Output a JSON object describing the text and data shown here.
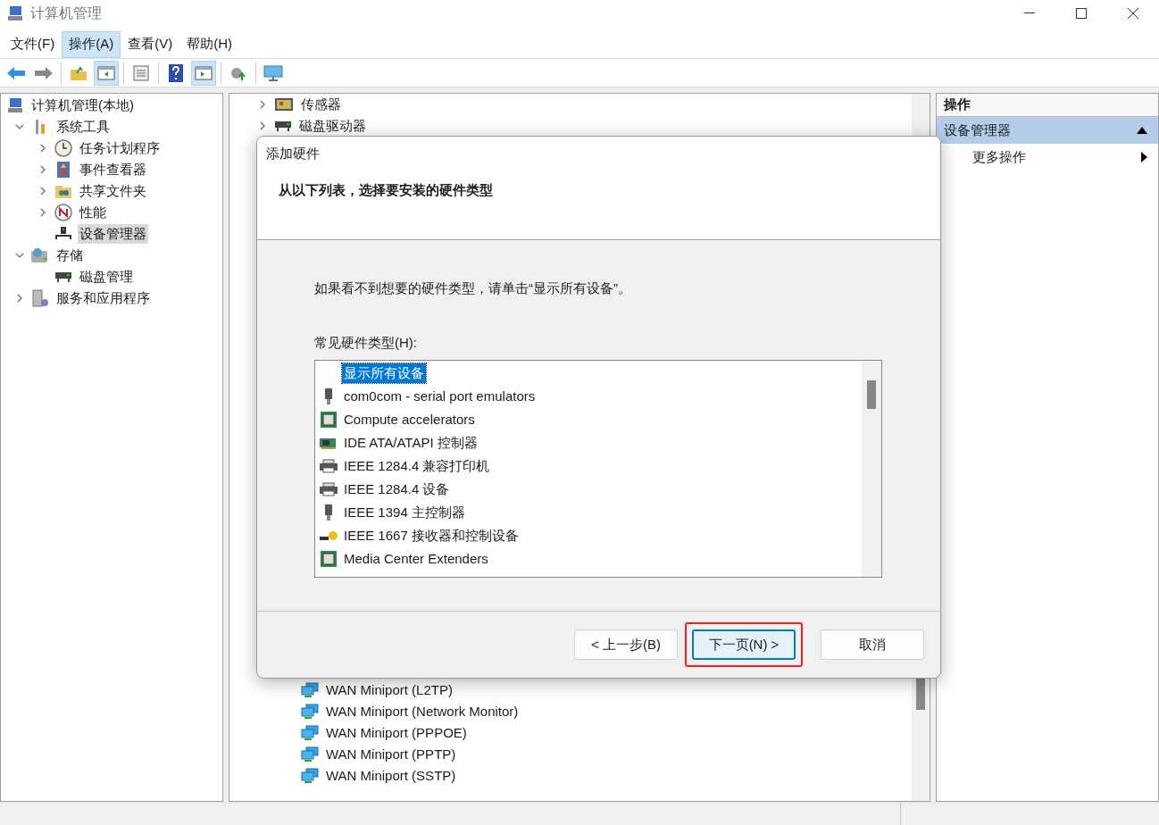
{
  "window": {
    "title": "计算机管理"
  },
  "menu": [
    {
      "label": "文件(F)",
      "selected": false
    },
    {
      "label": "操作(A)",
      "selected": true
    },
    {
      "label": "查看(V)",
      "selected": false
    },
    {
      "label": "帮助(H)",
      "selected": false
    }
  ],
  "toolbar": [
    {
      "kind": "back",
      "pressed": false
    },
    {
      "kind": "forward",
      "pressed": false
    },
    {
      "kind": "sep"
    },
    {
      "kind": "up",
      "pressed": false
    },
    {
      "kind": "tree",
      "pressed": true
    },
    {
      "kind": "sep"
    },
    {
      "kind": "props",
      "pressed": false
    },
    {
      "kind": "sep"
    },
    {
      "kind": "help",
      "pressed": false
    },
    {
      "kind": "pane",
      "pressed": true
    },
    {
      "kind": "sep"
    },
    {
      "kind": "export",
      "pressed": false
    },
    {
      "kind": "sep"
    },
    {
      "kind": "monitor",
      "pressed": false
    }
  ],
  "tree": [
    {
      "label": "计算机管理(本地)",
      "kind": "computer",
      "selected": false,
      "children": [
        {
          "label": "系统工具",
          "kind": "tools",
          "expanded": true,
          "selected": false,
          "children": [
            {
              "label": "任务计划程序",
              "kind": "clock",
              "expanded": false,
              "selected": false
            },
            {
              "label": "事件查看器",
              "kind": "log",
              "expanded": false,
              "selected": false
            },
            {
              "label": "共享文件夹",
              "kind": "share",
              "expanded": false,
              "selected": false
            },
            {
              "label": "性能",
              "kind": "perf",
              "expanded": false,
              "selected": false
            },
            {
              "label": "设备管理器",
              "kind": "device",
              "selected": true
            }
          ]
        },
        {
          "label": "存储",
          "kind": "storage",
          "expanded": true,
          "selected": false,
          "children": [
            {
              "label": "磁盘管理",
              "kind": "disk",
              "selected": false
            }
          ]
        },
        {
          "label": "服务和应用程序",
          "kind": "services",
          "expanded": false,
          "selected": false
        }
      ]
    }
  ],
  "device_list_top": [
    {
      "label": "传感器",
      "kind": "sensor"
    },
    {
      "label": "磁盘驱动器",
      "kind": "disk"
    }
  ],
  "device_list_bottom": [
    {
      "label": "WAN Miniport (L2TP)"
    },
    {
      "label": "WAN Miniport (Network Monitor)"
    },
    {
      "label": "WAN Miniport (PPPOE)"
    },
    {
      "label": "WAN Miniport (PPTP)"
    },
    {
      "label": "WAN Miniport (SSTP)"
    }
  ],
  "actions": {
    "header": "操作",
    "section": {
      "label": "设备管理器",
      "expanded": true
    },
    "items": [
      {
        "label": "更多操作"
      }
    ]
  },
  "dialog": {
    "title": "添加硬件",
    "heading": "从以下列表，选择要安装的硬件类型",
    "hint": "如果看不到想要的硬件类型，请单击“显示所有设备”。",
    "list_label": "常见硬件类型(H):",
    "items": [
      {
        "label": "显示所有设备",
        "kind": "none",
        "selected": true
      },
      {
        "label": "com0com - serial port emulators",
        "kind": "port",
        "selected": false
      },
      {
        "label": "Compute accelerators",
        "kind": "chip",
        "selected": false
      },
      {
        "label": "IDE ATA/ATAPI 控制器",
        "kind": "ide",
        "selected": false
      },
      {
        "label": "IEEE 1284.4 兼容打印机",
        "kind": "printer",
        "selected": false
      },
      {
        "label": "IEEE 1284.4 设备",
        "kind": "printer",
        "selected": false
      },
      {
        "label": "IEEE 1394 主控制器",
        "kind": "port",
        "selected": false
      },
      {
        "label": "IEEE 1667 接收器和控制设备",
        "kind": "key",
        "selected": false
      },
      {
        "label": "Media Center Extenders",
        "kind": "chip",
        "selected": false
      }
    ],
    "buttons": [
      {
        "label": "< 上一步(B)",
        "default": false,
        "highlighted": false
      },
      {
        "label": "下一页(N) >",
        "default": true,
        "highlighted": true
      },
      {
        "label": "取消",
        "default": false,
        "highlighted": false
      }
    ]
  }
}
